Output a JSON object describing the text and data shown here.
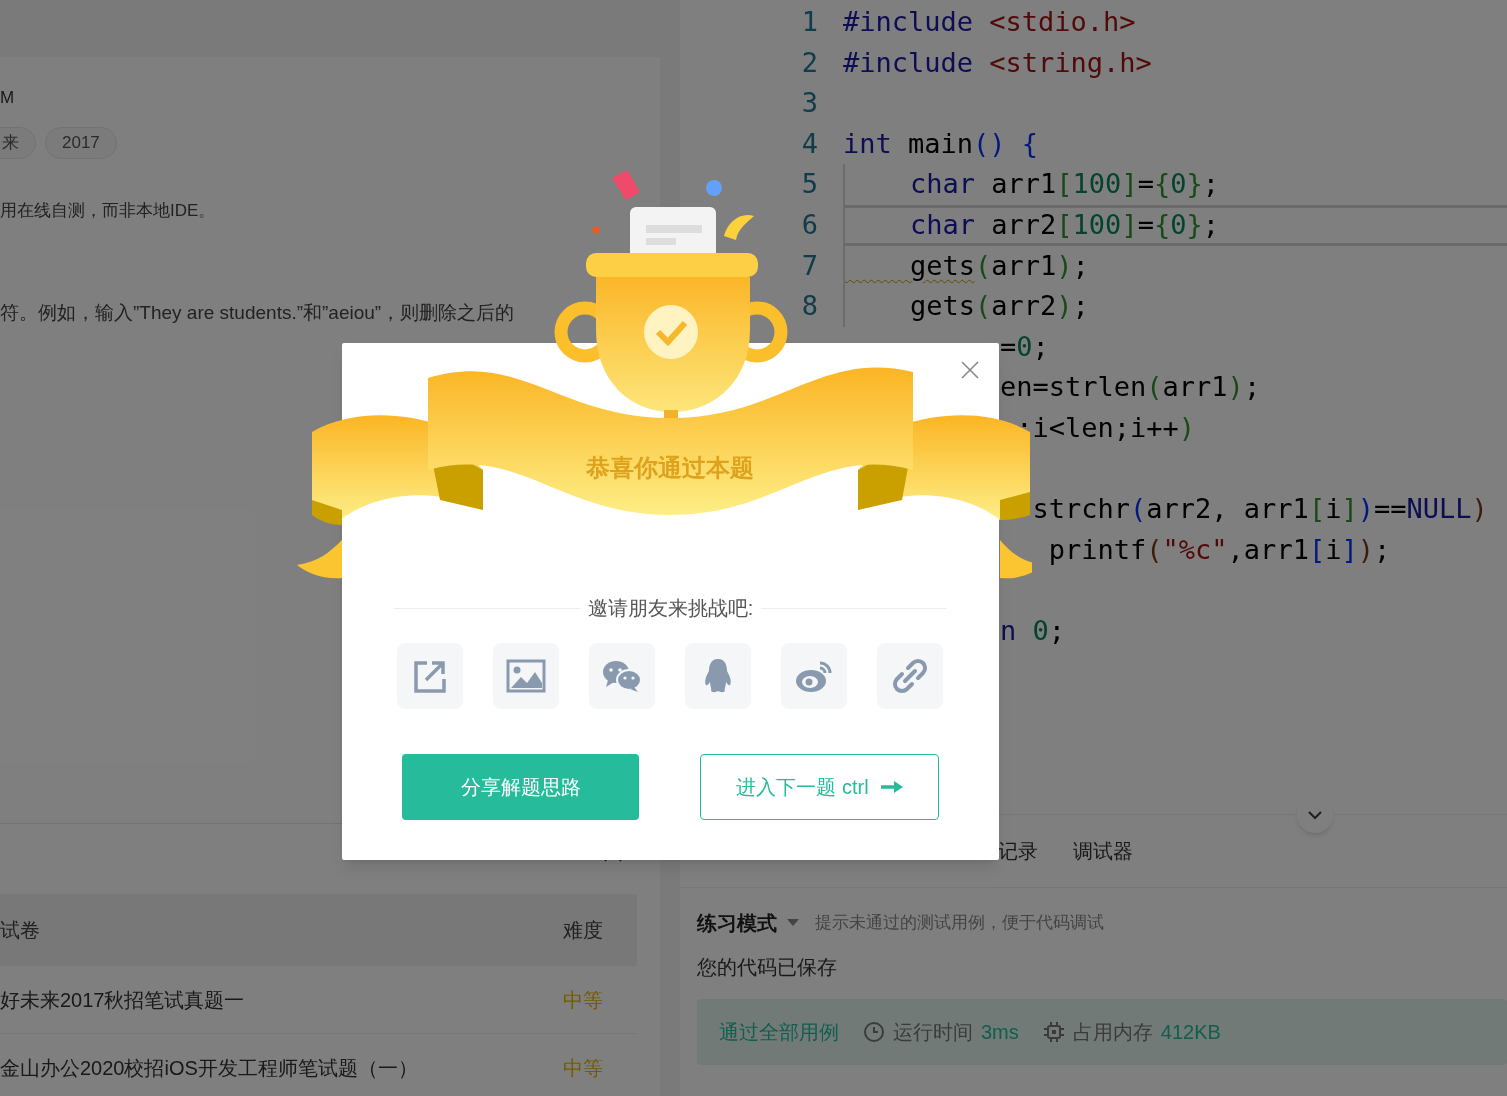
{
  "problem": {
    "heading_fragment": "M",
    "tags": [
      "来",
      "2017"
    ],
    "notes": [
      "用在线自测，而非本地IDE。",
      "符。例如，输入”They are students.”和”aeiou”，则删除之后的"
    ]
  },
  "related_papers": {
    "columns": [
      "试卷",
      "难度"
    ],
    "rows": [
      {
        "title": "好未来2017秋招笔试真题一",
        "difficulty": "中等"
      },
      {
        "title": "金山办公2020校招iOS开发工程师笔试题（一）",
        "difficulty": "中等"
      }
    ]
  },
  "editor": {
    "lines": [
      {
        "number": "1",
        "current": false,
        "tokens": [
          {
            "t": "#include",
            "kind": "kw"
          },
          {
            "t": " <stdio.h>",
            "kind": "str"
          }
        ]
      },
      {
        "number": "2",
        "current": false,
        "tokens": [
          {
            "t": "#include",
            "kind": "kw"
          },
          {
            "t": " <string.h>",
            "kind": "str"
          }
        ]
      },
      {
        "number": "3",
        "current": false
      },
      {
        "number": "4",
        "current": false,
        "tokens": [
          {
            "t": "int",
            "kind": "kw"
          },
          {
            "t": " main",
            "kind": "plain"
          },
          {
            "t": "()",
            "kind": "b1"
          },
          {
            "t": " {",
            "kind": "b1"
          }
        ]
      },
      {
        "number": "5",
        "current": false,
        "tokens": [
          {
            "t": "    char",
            "kind": "kw"
          },
          {
            "t": " arr1",
            "kind": "plain"
          },
          {
            "t": "[",
            "kind": "b2"
          },
          {
            "t": "100",
            "kind": "num"
          },
          {
            "t": "]",
            "kind": "b2"
          },
          {
            "t": "=",
            "kind": "plain"
          },
          {
            "t": "{",
            "kind": "b2"
          },
          {
            "t": "0",
            "kind": "num"
          },
          {
            "t": "}",
            "kind": "b2"
          },
          {
            "t": ";",
            "kind": "plain"
          }
        ]
      },
      {
        "number": "6",
        "current": true,
        "tokens": [
          {
            "t": "    char",
            "kind": "kw"
          },
          {
            "t": " arr2",
            "kind": "plain"
          },
          {
            "t": "[",
            "kind": "b2"
          },
          {
            "t": "100",
            "kind": "num"
          },
          {
            "t": "]",
            "kind": "b2"
          },
          {
            "t": "=",
            "kind": "plain"
          },
          {
            "t": "{",
            "kind": "b2"
          },
          {
            "t": "0",
            "kind": "num"
          },
          {
            "t": "}",
            "kind": "b2"
          },
          {
            "t": ";",
            "kind": "plain"
          }
        ]
      },
      {
        "number": "7",
        "current": false,
        "tokens": [
          {
            "t": "    gets",
            "kind": "plain",
            "warning": true
          },
          {
            "t": "(",
            "kind": "b2"
          },
          {
            "t": "arr1",
            "kind": "plain"
          },
          {
            "t": ")",
            "kind": "b2"
          },
          {
            "t": ";",
            "kind": "plain"
          }
        ]
      },
      {
        "number": "8",
        "current": false,
        "tokens": [
          {
            "t": "    gets",
            "kind": "plain",
            "warning": false
          },
          {
            "t": "(",
            "kind": "b2"
          },
          {
            "t": "arr2",
            "kind": "plain"
          },
          {
            "t": ")",
            "kind": "b2"
          },
          {
            "t": ";",
            "kind": "plain"
          }
        ]
      }
    ],
    "visible_tails": [
      {
        "after_blank_line": false,
        "tokens": [
          {
            "t": "=",
            "kind": "plain"
          },
          {
            "t": "0",
            "kind": "num"
          },
          {
            "t": ";",
            "kind": "plain"
          }
        ]
      },
      {
        "after_blank_line": false,
        "tokens": [
          {
            "t": "en=strlen",
            "kind": "plain"
          },
          {
            "t": "(",
            "kind": "b2"
          },
          {
            "t": "arr1",
            "kind": "plain"
          },
          {
            "t": ")",
            "kind": "b2"
          },
          {
            "t": ";",
            "kind": "plain"
          }
        ]
      },
      {
        "after_blank_line": false,
        "tokens": [
          {
            "t": " ;i<len;i++",
            "kind": "plain"
          },
          {
            "t": ")",
            "kind": "b2"
          }
        ]
      },
      {
        "after_blank_line": true,
        "tokens": [
          {
            "t": "  strchr",
            "kind": "plain"
          },
          {
            "t": "(",
            "kind": "b1"
          },
          {
            "t": "arr2, arr1",
            "kind": "plain"
          },
          {
            "t": "[",
            "kind": "b2"
          },
          {
            "t": "i",
            "kind": "plain"
          },
          {
            "t": "]",
            "kind": "b2"
          },
          {
            "t": ")",
            "kind": "b1"
          },
          {
            "t": "==",
            "kind": "plain"
          },
          {
            "t": "NULL",
            "kind": "kw"
          },
          {
            "t": ")",
            "kind": "b3"
          }
        ]
      },
      {
        "after_blank_line": false,
        "tokens": [
          {
            "t": "   printf",
            "kind": "plain"
          },
          {
            "t": "(",
            "kind": "b3"
          },
          {
            "t": "\"%c\"",
            "kind": "str"
          },
          {
            "t": ",arr1",
            "kind": "plain"
          },
          {
            "t": "[",
            "kind": "b1"
          },
          {
            "t": "i",
            "kind": "plain"
          },
          {
            "t": "]",
            "kind": "b1"
          },
          {
            "t": ")",
            "kind": "b3"
          },
          {
            "t": ";",
            "kind": "plain"
          }
        ]
      },
      {
        "after_blank_line": true,
        "tokens": [
          {
            "t": "n",
            "kind": "kw"
          },
          {
            "t": " 0",
            "kind": "num"
          },
          {
            "t": ";",
            "kind": "plain"
          }
        ]
      }
    ]
  },
  "bottom_tabs": [
    {
      "label": "记录",
      "selected": false
    },
    {
      "label": "调试器",
      "selected": false
    }
  ],
  "mode": {
    "label": "练习模式",
    "hint": "提示未通过的测试用例，便于代码调试"
  },
  "save_status": "您的代码已保存",
  "result": {
    "status": "通过全部用例",
    "runtime_label": "运行时间",
    "runtime": "3ms",
    "memory_label": "占用内存",
    "memory": "412KB"
  },
  "dialog": {
    "title": "恭喜你通过本题",
    "invite": "邀请朋友来挑战吧:",
    "share_options": [
      {
        "kind": "external"
      },
      {
        "kind": "image"
      },
      {
        "kind": "chat"
      },
      {
        "kind": "penguin"
      },
      {
        "kind": "waves"
      },
      {
        "kind": "link"
      }
    ],
    "primary_button": "分享解题思路",
    "next_button": "进入下一题 ctrl"
  }
}
